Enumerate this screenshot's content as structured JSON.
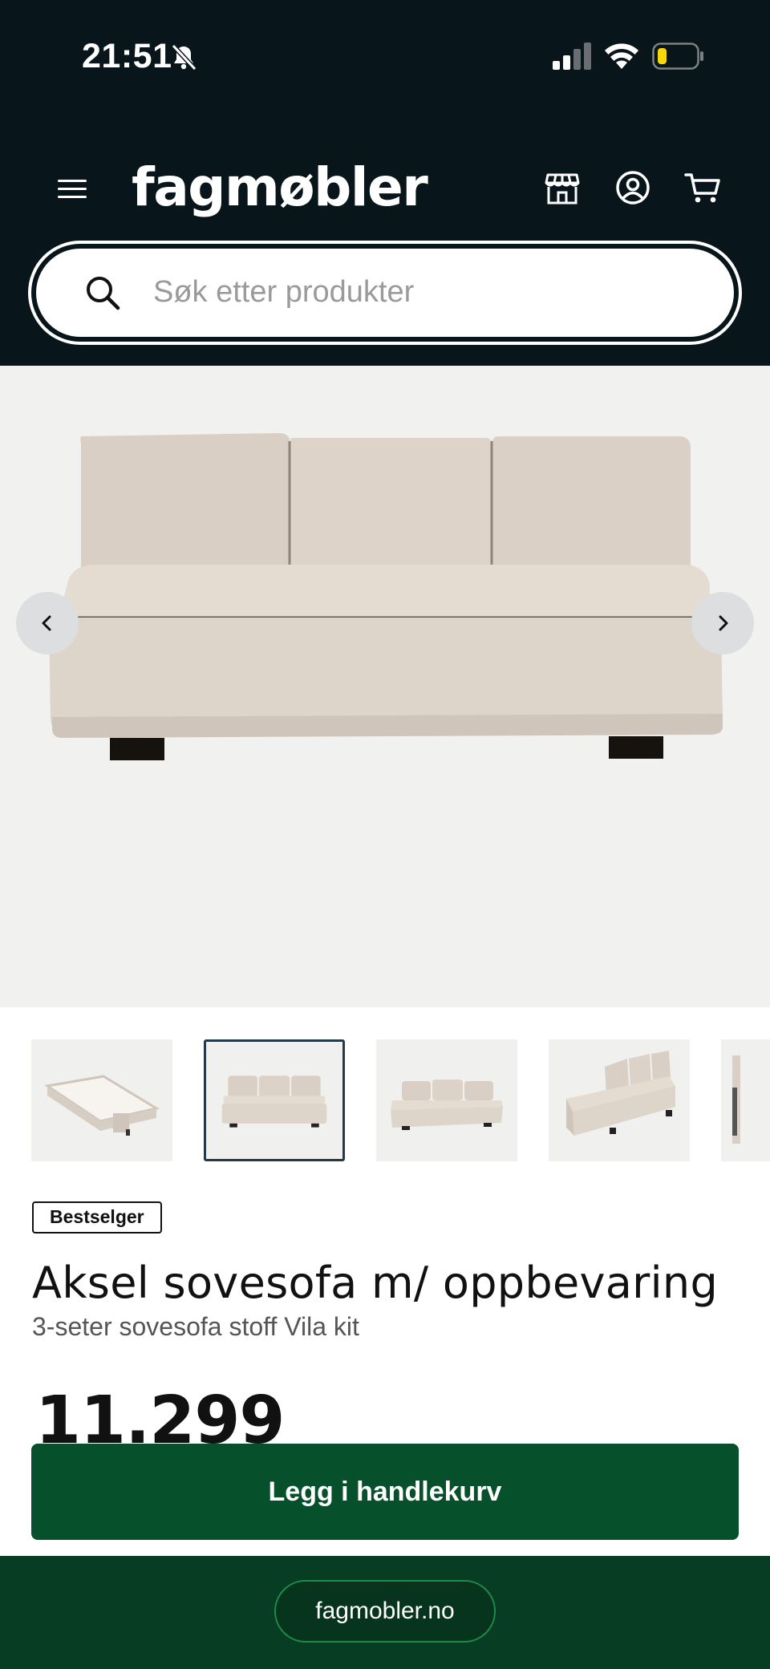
{
  "status_bar": {
    "time": "21:51",
    "icons": [
      "bell-slash-icon",
      "cellular-signal-icon",
      "wifi-icon",
      "battery-low-icon"
    ],
    "battery_color": "#f5d90a"
  },
  "header": {
    "logo": "fagmøbler",
    "background": "#08151a",
    "icons": [
      "menu-icon",
      "store-icon",
      "user-icon",
      "cart-icon"
    ]
  },
  "search": {
    "placeholder": "Søk etter produkter",
    "value": ""
  },
  "gallery": {
    "image": "beige-three-seat-sofa-bed",
    "prev_icon": "chevron-left-icon",
    "next_icon": "chevron-right-icon",
    "thumbnails": [
      "sofa-bed-open",
      "sofa-front",
      "sofa-front-low",
      "sofa-angle",
      "sofa-partial"
    ],
    "selected_thumbnail": 1
  },
  "product": {
    "badge": "Bestselger",
    "title": "Aksel sovesofa m/ oppbevaring",
    "subtitle": "3-seter sovesofa stoff Vila kit",
    "price": "11.299"
  },
  "cta": {
    "add_to_cart": "Legg i handlekurv",
    "color": "#07502c"
  },
  "browser": {
    "url": "fagmobler.no"
  }
}
